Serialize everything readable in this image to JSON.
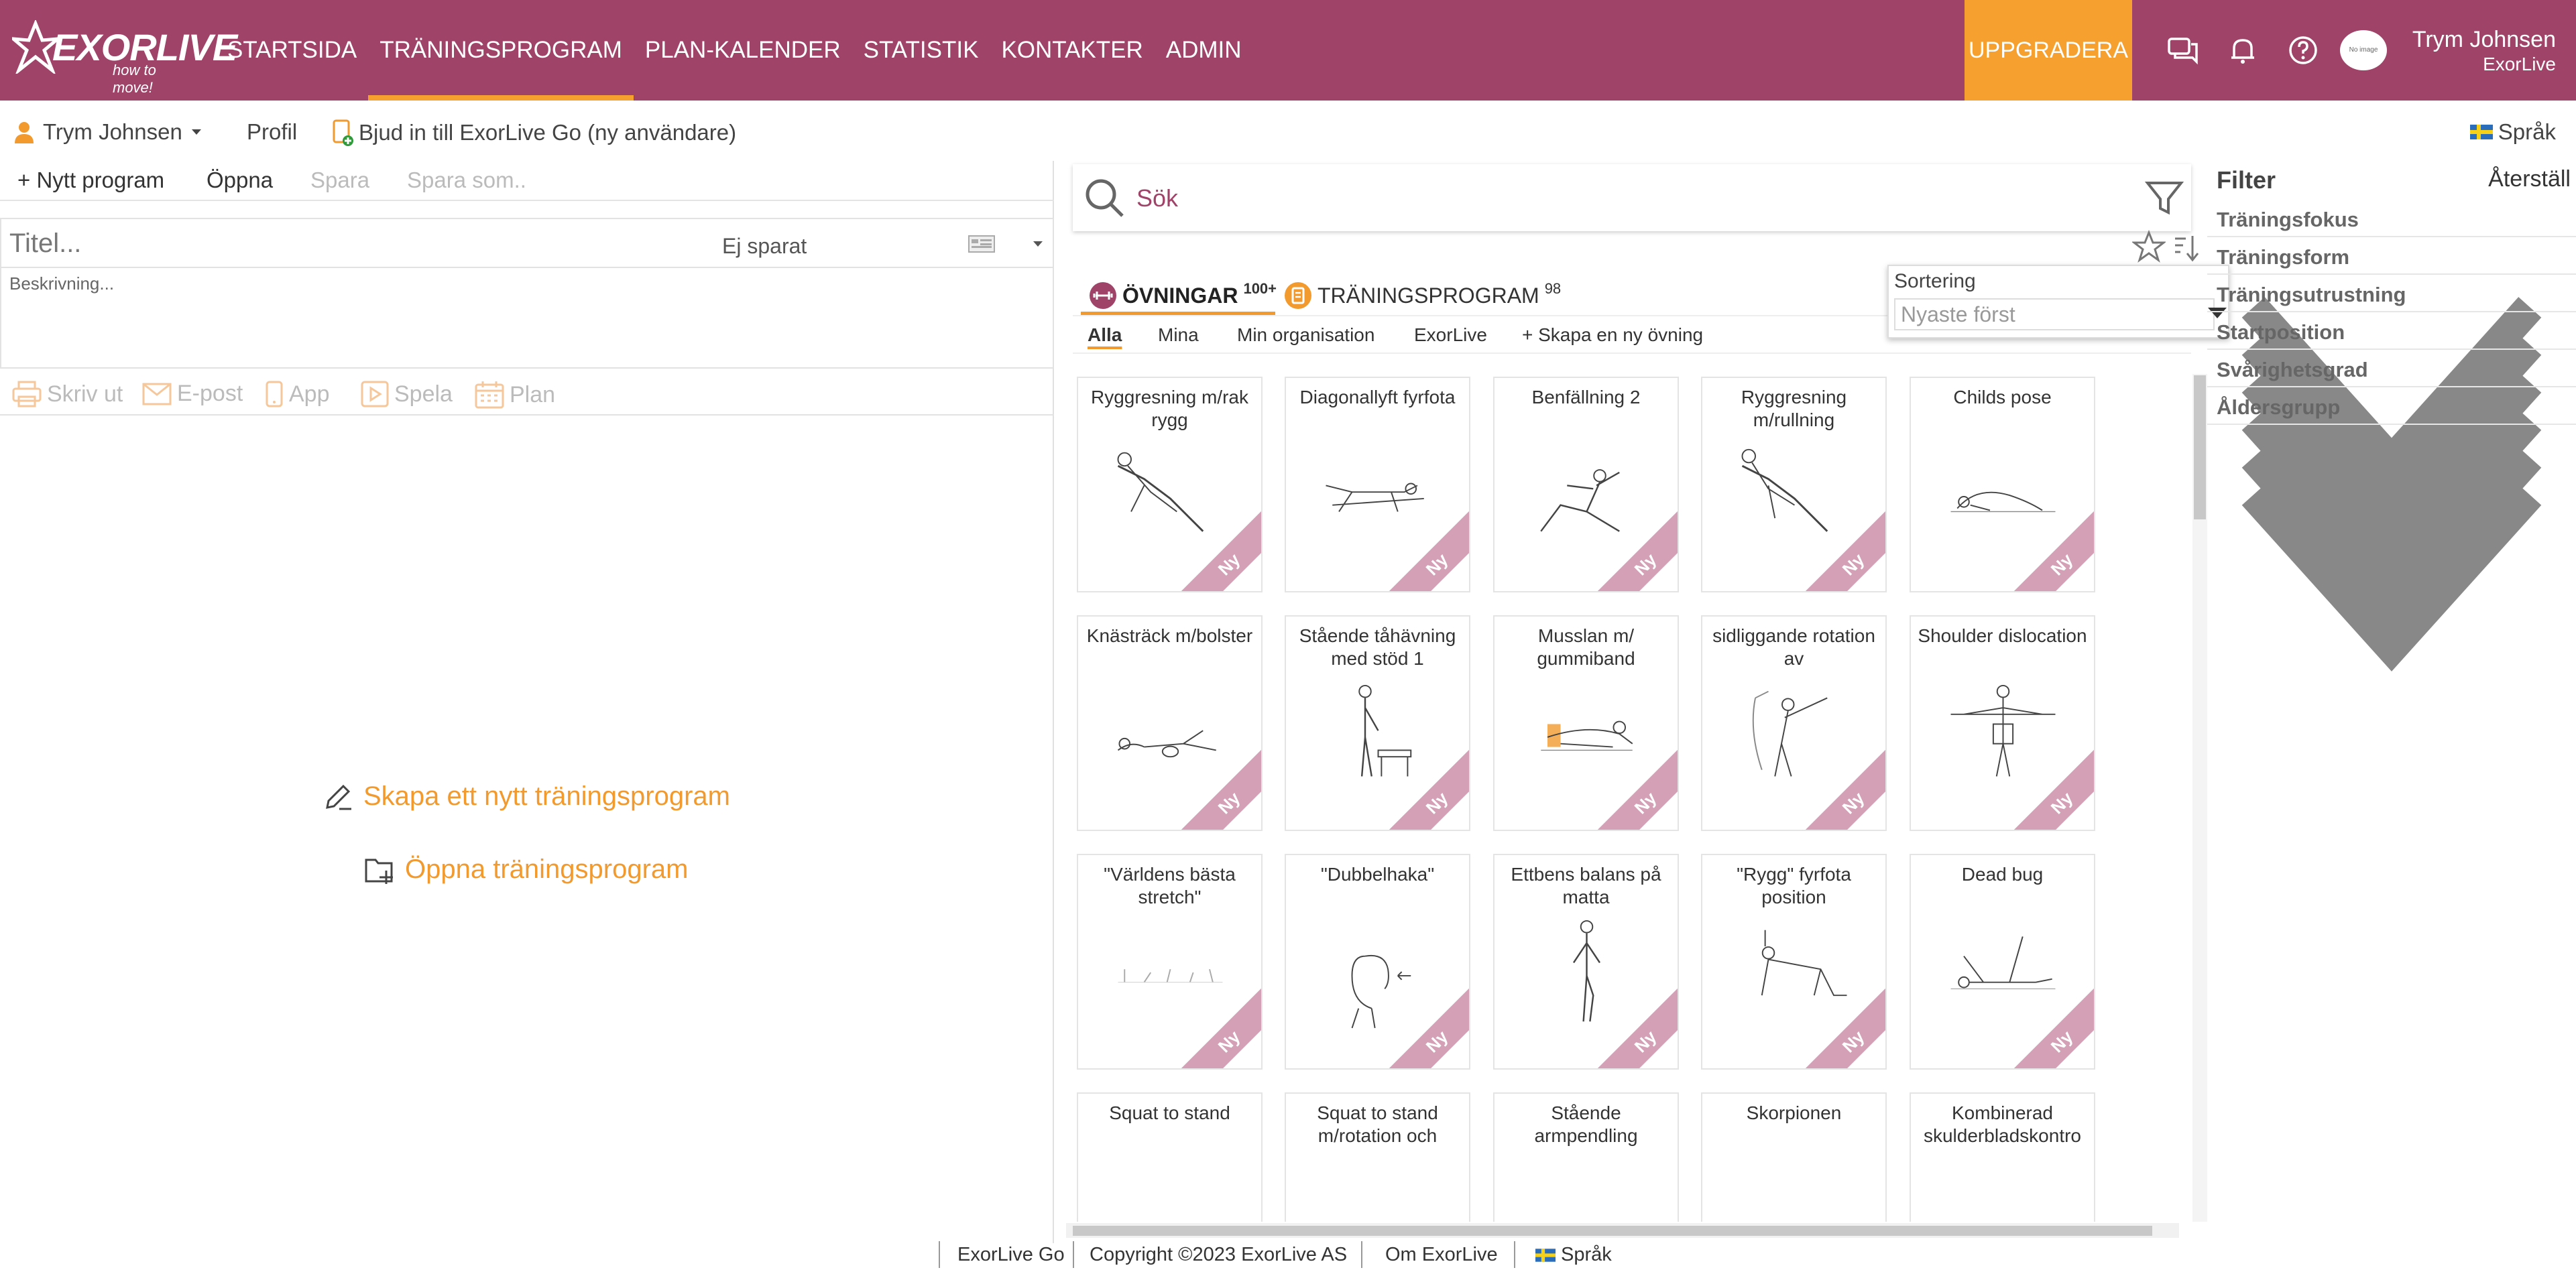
{
  "brand": {
    "name": "EXORLIVE",
    "tagline": "how to move!",
    "color": "#a04369",
    "accent": "#f6a02f"
  },
  "nav": {
    "links": [
      "STARTSIDA",
      "TRÄNINGSPROGRAM",
      "PLAN-KALENDER",
      "STATISTIK",
      "KONTAKTER",
      "ADMIN"
    ],
    "active_index": 1,
    "upgrade_label": "UPPGRADERA",
    "avatar_text": "No image",
    "user_name": "Trym Johnsen",
    "user_org": "ExorLive",
    "icons": [
      "chat-icon",
      "bell-icon",
      "help-icon"
    ]
  },
  "subbar": {
    "user_menu": "Trym Johnsen",
    "profile": "Profil",
    "invite": "Bjud in till ExorLive Go (ny användare)",
    "language": "Språk"
  },
  "program_toolbar": {
    "new": "+ Nytt program",
    "open": "Öppna",
    "save": "Spara",
    "save_as": "Spara som.."
  },
  "program_editor": {
    "title_placeholder": "Titel...",
    "status": "Ej sparat",
    "description_placeholder": "Beskrivning...",
    "actions": [
      "Skriv ut",
      "E-post",
      "App",
      "Spela",
      "Plan"
    ]
  },
  "empty_state": {
    "create": "Skapa ett nytt träningsprogram",
    "open": "Öppna träningsprogram"
  },
  "search": {
    "placeholder": "Sök"
  },
  "library_tabs": [
    {
      "label": "ÖVNINGAR",
      "count": "100+"
    },
    {
      "label": "TRÄNINGSPROGRAM",
      "count": "98"
    }
  ],
  "sub_tabs": [
    "Alla",
    "Mina",
    "Min organisation",
    "ExorLive",
    "+ Skapa en ny övning"
  ],
  "sort": {
    "label": "Sortering",
    "value": "Nyaste först"
  },
  "badge_label": "Ny",
  "exercises": [
    "Ryggresning m/rak rygg",
    "Diagonallyft fyrfota",
    "Benfällning 2",
    "Ryggresning m/rullning",
    "Childs pose",
    "Knästräck m/bolster",
    "Stående tåhävning med stöd 1",
    "Musslan m/ gummiband",
    "sidliggande rotation av",
    "Shoulder dislocation",
    "\"Världens bästa stretch\"",
    "\"Dubbelhaka\"",
    "Ettbens balans på matta",
    "\"Rygg\" fyrfota position",
    "Dead bug",
    "Squat to stand",
    "Squat to stand m/rotation och",
    "Stående armpendling",
    "Skorpionen",
    "Kombinerad skulderbladskontro"
  ],
  "filter": {
    "title": "Filter",
    "reset": "Återställ",
    "groups": [
      "Träningsfokus",
      "Träningsform",
      "Träningsutrustning",
      "Startposition",
      "Svårighetsgrad",
      "Åldersgrupp"
    ]
  },
  "footer": {
    "app": "ExorLive Go",
    "copyright": "Copyright ©2023 ExorLive AS",
    "about": "Om ExorLive",
    "language": "Språk"
  }
}
